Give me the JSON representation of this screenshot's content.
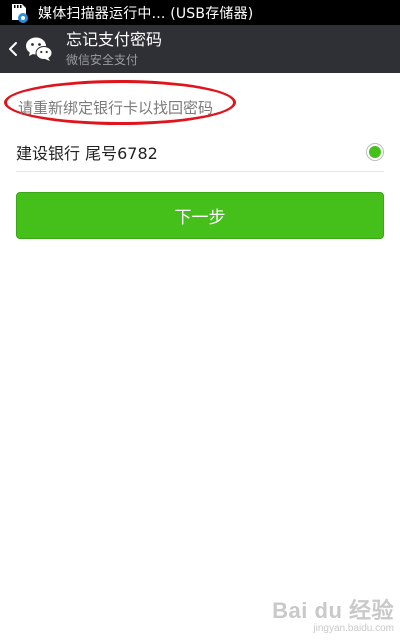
{
  "status_bar": {
    "notification_text": "媒体扫描器运行中... (USB存储器)",
    "icon": "sd-card-gear-icon"
  },
  "header": {
    "title": "忘记支付密码",
    "subtitle": "微信安全支付",
    "back_icon": "chevron-left-icon",
    "logo_icon": "wechat-logo-icon"
  },
  "main": {
    "hint_text": "请重新绑定银行卡以找回密码",
    "bank_card": {
      "label": "建设银行 尾号6782",
      "selected": true
    },
    "next_button_label": "下一步"
  },
  "watermark": {
    "logo_text": "Bai du 经验",
    "url": "jingyan.baidu.com"
  },
  "colors": {
    "status_bar_bg": "#000000",
    "action_bar_bg": "#2f3035",
    "accent_green": "#45c01a",
    "annotation_red": "#e0141c"
  }
}
